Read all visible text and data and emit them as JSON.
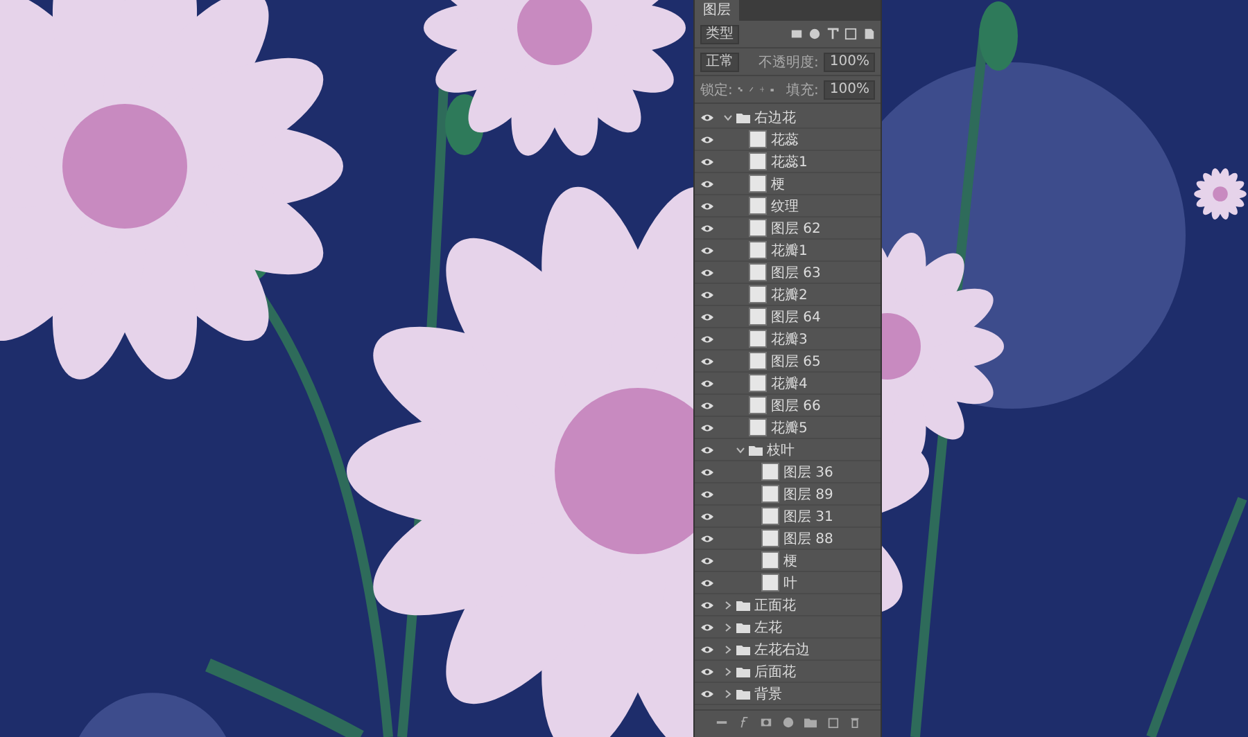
{
  "layers_panel": {
    "title": "图层",
    "filter": {
      "value": "类型"
    },
    "blend_mode": {
      "value": "正常"
    },
    "opacity": {
      "label": "不透明度:",
      "value": "100%"
    },
    "lock": {
      "label": "锁定:"
    },
    "fill": {
      "label": "填充:",
      "value": "100%"
    },
    "layers": [
      {
        "kind": "group",
        "name": "右边花",
        "visible": true,
        "expanded": true,
        "children": [
          {
            "kind": "layer",
            "name": "花蕊",
            "visible": true
          },
          {
            "kind": "layer",
            "name": "花蕊1",
            "visible": true
          },
          {
            "kind": "layer",
            "name": "梗",
            "visible": true
          },
          {
            "kind": "layer",
            "name": "纹理",
            "visible": true
          },
          {
            "kind": "layer",
            "name": "图层 62",
            "visible": true
          },
          {
            "kind": "layer",
            "name": "花瓣1",
            "visible": true
          },
          {
            "kind": "layer",
            "name": "图层 63",
            "visible": true
          },
          {
            "kind": "layer",
            "name": "花瓣2",
            "visible": true
          },
          {
            "kind": "layer",
            "name": "图层 64",
            "visible": true
          },
          {
            "kind": "layer",
            "name": "花瓣3",
            "visible": true
          },
          {
            "kind": "layer",
            "name": "图层 65",
            "visible": true
          },
          {
            "kind": "layer",
            "name": "花瓣4",
            "visible": true
          },
          {
            "kind": "layer",
            "name": "图层 66",
            "visible": true
          },
          {
            "kind": "layer",
            "name": "花瓣5",
            "visible": true
          },
          {
            "kind": "group",
            "name": "枝叶",
            "visible": true,
            "expanded": true,
            "children": [
              {
                "kind": "layer",
                "name": "图层 36",
                "visible": true
              },
              {
                "kind": "layer",
                "name": "图层 89",
                "visible": true
              },
              {
                "kind": "layer",
                "name": "图层 31",
                "visible": true
              },
              {
                "kind": "layer",
                "name": "图层 88",
                "visible": true
              },
              {
                "kind": "layer",
                "name": "梗",
                "visible": true
              },
              {
                "kind": "layer",
                "name": "叶",
                "visible": true
              }
            ]
          }
        ]
      },
      {
        "kind": "group",
        "name": "正面花",
        "visible": true,
        "expanded": false
      },
      {
        "kind": "group",
        "name": "左花",
        "visible": true,
        "expanded": false
      },
      {
        "kind": "group",
        "name": "左花右边",
        "visible": true,
        "expanded": false
      },
      {
        "kind": "group",
        "name": "后面花",
        "visible": true,
        "expanded": false
      },
      {
        "kind": "group",
        "name": "背景",
        "visible": true,
        "expanded": false
      }
    ]
  }
}
